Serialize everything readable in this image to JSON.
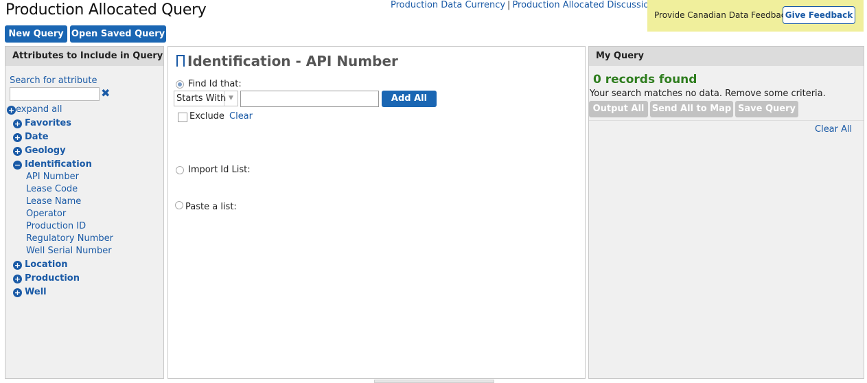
{
  "header": {
    "title": "Production Allocated Query",
    "links": [
      "Production Data Currency",
      "Production Allocated Discussion"
    ],
    "separator": "|",
    "feedback": {
      "text": "Provide Canadian Data Feedback",
      "button": "Give Feedback",
      "background": "#f0ef9c"
    }
  },
  "toolbar": {
    "new_query": "New Query",
    "open_saved_query": "Open Saved Query",
    "accent": "#1a66b3"
  },
  "sidebar": {
    "title": "Attributes to Include in Query",
    "search_label": "Search for attribute",
    "search_value": "",
    "clear_icon": "close-x-icon",
    "expand_all": "expand all",
    "items": [
      {
        "label": "Favorites",
        "expanded": false
      },
      {
        "label": "Date",
        "expanded": false
      },
      {
        "label": "Geology",
        "expanded": false
      },
      {
        "label": "Identification",
        "expanded": true,
        "children": [
          "API Number",
          "Lease Code",
          "Lease Name",
          "Operator",
          "Production ID",
          "Regulatory Number",
          "Well Serial Number"
        ]
      },
      {
        "label": "Location",
        "expanded": false
      },
      {
        "label": "Production",
        "expanded": false
      },
      {
        "label": "Well",
        "expanded": false
      }
    ]
  },
  "main": {
    "title": "Identification - API Number",
    "find_label": "Find Id that:",
    "match_select": "Starts With",
    "id_value": "",
    "add_all": "Add All",
    "exclude_label": "Exclude",
    "clear_label": "Clear",
    "import_label": "Import Id List:",
    "paste_label": "Paste a list:"
  },
  "my_query": {
    "title": "My Query",
    "records": "0 records found",
    "message": "Your search matches no data. Remove some criteria.",
    "buttons": [
      "Output All",
      "Send All to Map",
      "Save Query"
    ],
    "clear_all": "Clear All",
    "records_color": "#2e7d1e"
  }
}
